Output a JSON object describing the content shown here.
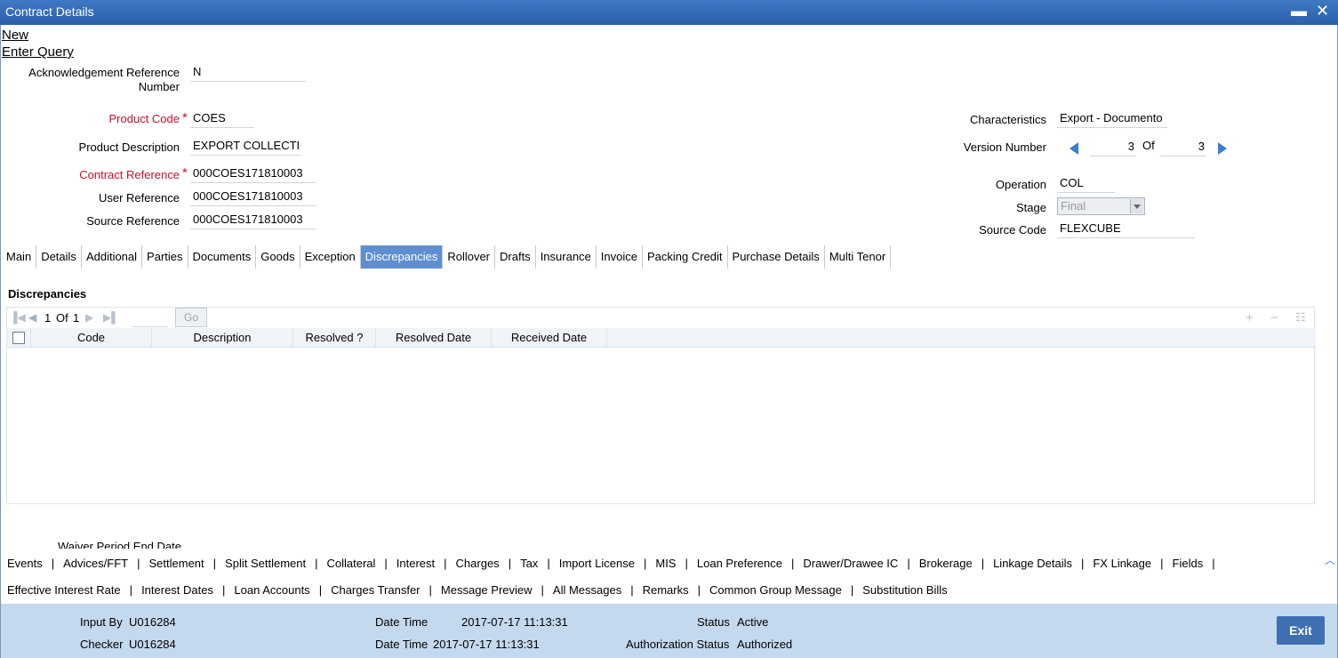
{
  "window": {
    "title": "Contract Details",
    "minimize": "▬",
    "close": "✕"
  },
  "menu": {
    "new": "New",
    "enter_query": "Enter Query"
  },
  "form": {
    "ack_ref_label_1": "Acknowledgement Reference",
    "ack_ref_label_2": "Number",
    "ack_ref_value": "N",
    "product_code_label": "Product Code",
    "product_code_value": "COES",
    "product_desc_label": "Product Description",
    "product_desc_value": "EXPORT COLLECTIO",
    "contract_ref_label": "Contract Reference",
    "contract_ref_value": "000COES171810003",
    "user_ref_label": "User Reference",
    "user_ref_value": "000COES171810003",
    "source_ref_label": "Source Reference",
    "source_ref_value": "000COES171810003",
    "required_mark": "*",
    "characteristics_label": "Characteristics",
    "characteristics_value": "Export  - Documento",
    "version_label": "Version Number",
    "version_current": "3",
    "version_of": "Of",
    "version_total": "3",
    "operation_label": "Operation",
    "operation_value": "COL",
    "stage_label": "Stage",
    "stage_value": "Final",
    "source_code_label": "Source Code",
    "source_code_value": "FLEXCUBE"
  },
  "tabs": [
    "Main",
    "Details",
    "Additional",
    "Parties",
    "Documents",
    "Goods",
    "Exception",
    "Discrepancies",
    "Rollover",
    "Drafts",
    "Insurance",
    "Invoice",
    "Packing Credit",
    "Purchase Details",
    "Multi Tenor"
  ],
  "active_tab": "Discrepancies",
  "discrepancies": {
    "title": "Discrepancies",
    "pager_page": "1",
    "pager_of": "Of",
    "pager_total": "1",
    "go_label": "Go",
    "columns": [
      "Code",
      "Description",
      "Resolved ?",
      "Resolved Date",
      "Received Date"
    ]
  },
  "hidden_label": "Waiver Period End Date",
  "links_row1": [
    "Events",
    "Advices/FFT",
    "Settlement",
    "Split Settlement",
    "Collateral",
    "Interest",
    "Charges",
    "Tax",
    "Import License",
    "MIS",
    "Loan Preference",
    "Drawer/Drawee IC",
    "Brokerage",
    "Linkage Details",
    "FX Linkage",
    "Fields"
  ],
  "links_row2": [
    "Effective Interest Rate",
    "Interest Dates",
    "Loan Accounts",
    "Charges Transfer",
    "Message Preview",
    "All Messages",
    "Remarks",
    "Common Group Message",
    "Substitution Bills"
  ],
  "footer": {
    "input_by_label": "Input By",
    "input_by_value": "U016284",
    "checker_label": "Checker",
    "checker_value": "U016284",
    "date_time_label": "Date Time",
    "date_time_1": "2017-07-17 11:13:31",
    "date_time_2": "2017-07-17 11:13:31",
    "status_label": "Status",
    "status_value": "Active",
    "auth_status_label": "Authorization Status",
    "auth_status_value": "Authorized",
    "exit_label": "Exit"
  },
  "colors": {
    "title_bar": "#2b5fa9",
    "active_tab": "#5f8fd0",
    "footer_bg": "#c5d9ee",
    "required": "#c8102e",
    "exit_button": "#3f6fb0"
  }
}
